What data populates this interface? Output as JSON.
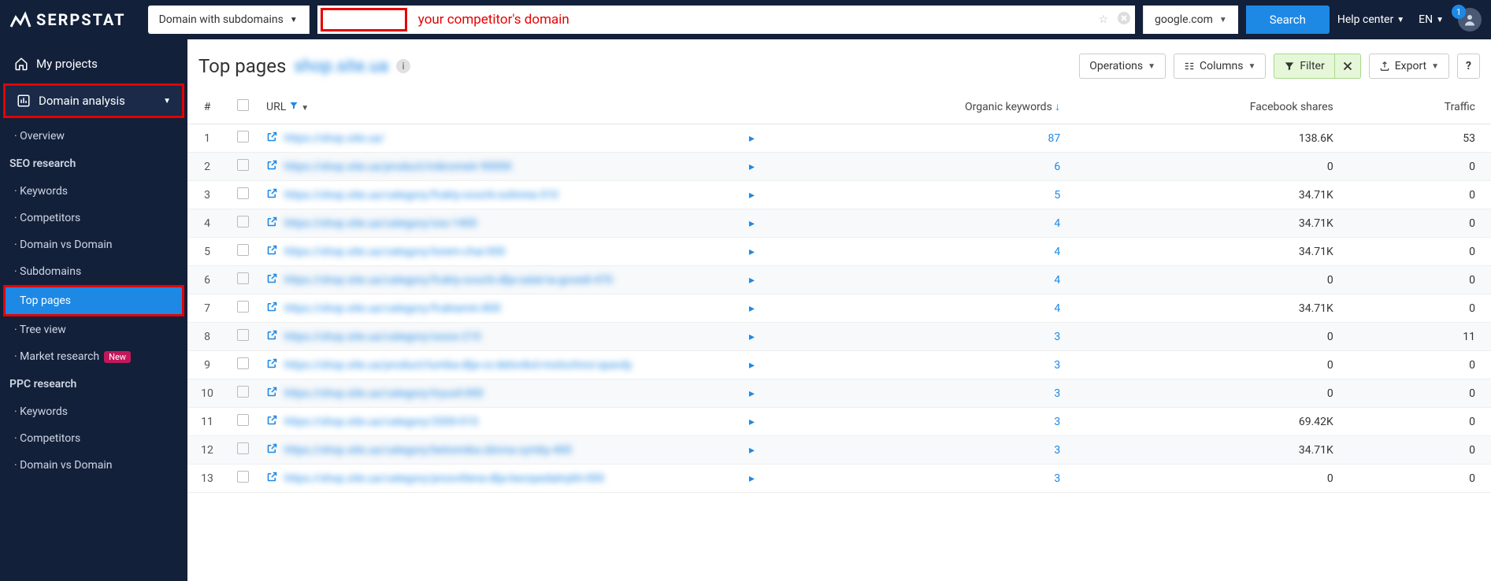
{
  "topbar": {
    "brand": "SERPSTAT",
    "domain_selector": "Domain with subdomains",
    "hint": "your competitor's domain",
    "search_engine": "google.com",
    "search_btn": "Search",
    "help_center": "Help center",
    "lang": "EN",
    "notif_count": "1"
  },
  "sidebar": {
    "my_projects": "My projects",
    "domain_analysis": "Domain analysis",
    "overview": "Overview",
    "seo_research": "SEO research",
    "keywords": "Keywords",
    "competitors": "Competitors",
    "domain_vs_domain": "Domain vs Domain",
    "subdomains": "Subdomains",
    "top_pages": "Top pages",
    "tree_view": "Tree view",
    "market_research": "Market research",
    "new_label": "New",
    "ppc_research": "PPC research",
    "ppc_keywords": "Keywords",
    "ppc_competitors": "Competitors",
    "ppc_dvd": "Domain vs Domain"
  },
  "page": {
    "title": "Top pages",
    "blurred_domain": "shop.site.ua"
  },
  "toolbar": {
    "operations": "Operations",
    "columns": "Columns",
    "filter": "Filter",
    "export": "Export",
    "help": "?"
  },
  "columns": {
    "idx": "#",
    "url": "URL",
    "organic": "Organic keywords",
    "facebook": "Facebook shares",
    "traffic": "Traffic"
  },
  "rows": [
    {
      "idx": "1",
      "url": "https://shop.site.ua/",
      "organic": "87",
      "fb": "138.6K",
      "traffic": "53"
    },
    {
      "idx": "2",
      "url": "https://shop.site.ua/product/mikrometr-90000",
      "organic": "6",
      "fb": "0",
      "traffic": "0"
    },
    {
      "idx": "3",
      "url": "https://shop.site.ua/category/frukty-ovochi-solinnia-310",
      "organic": "5",
      "fb": "34.71K",
      "traffic": "0"
    },
    {
      "idx": "4",
      "url": "https://shop.site.ua/category/sss-1400",
      "organic": "4",
      "fb": "34.71K",
      "traffic": "0"
    },
    {
      "idx": "5",
      "url": "https://shop.site.ua/category/lorem-chai-000",
      "organic": "4",
      "fb": "34.71K",
      "traffic": "0"
    },
    {
      "idx": "6",
      "url": "https://shop.site.ua/category/frukty-ovochi-dlja-salat-ta-govedi-470",
      "organic": "4",
      "fb": "0",
      "traffic": "0"
    },
    {
      "idx": "7",
      "url": "https://shop.site.ua/category/fruktamin-800",
      "organic": "4",
      "fb": "34.71K",
      "traffic": "0"
    },
    {
      "idx": "8",
      "url": "https://shop.site.ua/category/xxxxx-210",
      "organic": "3",
      "fb": "0",
      "traffic": "11"
    },
    {
      "idx": "9",
      "url": "https://shop.site.ua/product/tumba-dlja-vz-delovikol-molochnoi-spavdy",
      "organic": "3",
      "fb": "0",
      "traffic": "0"
    },
    {
      "idx": "10",
      "url": "https://shop.site.ua/category/tryusil-000",
      "organic": "3",
      "fb": "0",
      "traffic": "0"
    },
    {
      "idx": "11",
      "url": "https://shop.site.ua/category/2000-010",
      "organic": "3",
      "fb": "69.42K",
      "traffic": "0"
    },
    {
      "idx": "12",
      "url": "https://shop.site.ua/category/betonnika-zbivna-cymby-400",
      "organic": "3",
      "fb": "34.71K",
      "traffic": "0"
    },
    {
      "idx": "13",
      "url": "https://shop.site.ua/category/prosvitlena-dlja-bezspedalnykh-000",
      "organic": "3",
      "fb": "0",
      "traffic": "0"
    }
  ]
}
